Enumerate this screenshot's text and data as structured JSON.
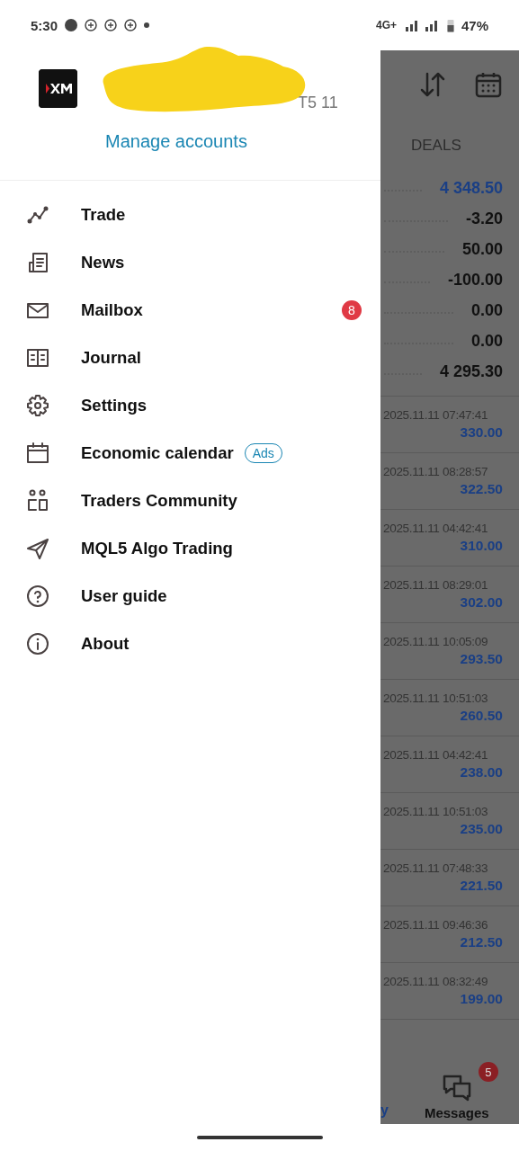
{
  "status_bar": {
    "time": "5:30",
    "network": "4G+",
    "battery": "47%"
  },
  "account": {
    "server_fragment": "T5 11",
    "manage_link": "Manage accounts"
  },
  "menu": [
    {
      "label": "Trade"
    },
    {
      "label": "News"
    },
    {
      "label": "Mailbox",
      "badge": "8"
    },
    {
      "label": "Journal"
    },
    {
      "label": "Settings"
    },
    {
      "label": "Economic calendar",
      "tag": "Ads"
    },
    {
      "label": "Traders Community"
    },
    {
      "label": "MQL5 Algo Trading"
    },
    {
      "label": "User guide"
    },
    {
      "label": "About"
    }
  ],
  "background": {
    "tab": "DEALS",
    "summary": [
      {
        "value": "4 348.50",
        "highlight": true
      },
      {
        "value": "-3.20",
        "highlight": false
      },
      {
        "value": "50.00",
        "highlight": false
      },
      {
        "value": "-100.00",
        "highlight": false
      },
      {
        "value": "0.00",
        "highlight": false
      },
      {
        "value": "0.00",
        "highlight": false
      },
      {
        "value": "4 295.30",
        "highlight": false
      }
    ],
    "deals": [
      {
        "time": "2025.11.11 07:47:41",
        "profit": "330.00"
      },
      {
        "time": "2025.11.11 08:28:57",
        "profit": "322.50"
      },
      {
        "time": "2025.11.11 04:42:41",
        "profit": "310.00"
      },
      {
        "time": "2025.11.11 08:29:01",
        "profit": "302.00"
      },
      {
        "time": "2025.11.11 10:05:09",
        "profit": "293.50"
      },
      {
        "time": "2025.11.11 10:51:03",
        "profit": "260.50"
      },
      {
        "time": "2025.11.11 04:42:41",
        "profit": "238.00"
      },
      {
        "time": "2025.11.11 10:51:03",
        "profit": "235.00"
      },
      {
        "time": "2025.11.11 07:48:33",
        "profit": "221.50"
      },
      {
        "time": "2025.11.11 09:46:36",
        "profit": "212.50"
      },
      {
        "time": "2025.11.11 08:32:49",
        "profit": "199.00"
      }
    ],
    "nav": {
      "fragment": "y",
      "messages_label": "Messages",
      "messages_badge": "5"
    }
  }
}
